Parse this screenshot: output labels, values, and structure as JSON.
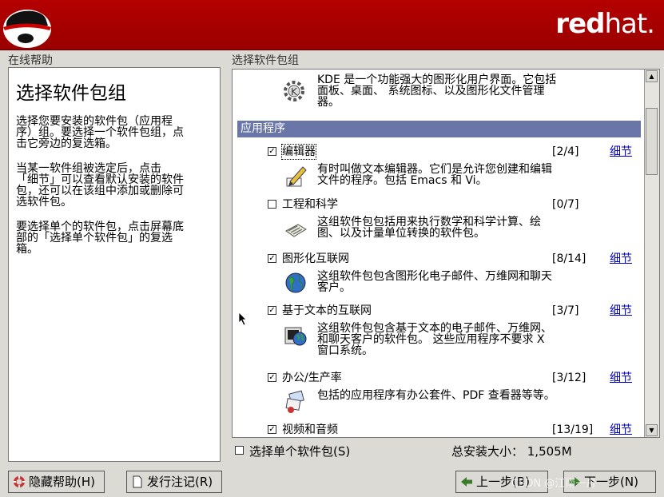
{
  "header": {
    "brand_bold": "red",
    "brand_thin": "hat."
  },
  "help": {
    "section_label": "在线帮助",
    "title": "选择软件包组",
    "paragraphs": [
      [
        "选择您要安装的软件包（应用程",
        "序）组。要选择一个软件包组，点",
        "击它旁边的复选箱。"
      ],
      [
        "当某一软件组被选定后，点击",
        "「细节」可以查看默认安装的软件",
        "包，还可以在该组中添加或删除可",
        "选软件包。"
      ],
      [
        "要选择单个的软件包，点击屏幕底",
        "部的「选择单个软件包」的复选",
        "箱。"
      ]
    ]
  },
  "packages": {
    "section_label": "选择软件包组",
    "kde_desc": [
      "KDE 是一个功能强大的图形化用户界面。它包括",
      "面板、桌面、 系统图标、以及图形化文件管理",
      "器。"
    ],
    "category": "应用程序",
    "groups": [
      {
        "name": "编辑器",
        "checked": true,
        "count": "[2/4]",
        "link": "细节",
        "icon": "edit-pencil-icon",
        "desc": [
          "有时叫做文本编辑器。它们是允许您创建和编辑",
          "文件的程序。包括 Emacs 和 Vi。"
        ]
      },
      {
        "name": "工程和科学",
        "checked": false,
        "count": "[0/7]",
        "link": "",
        "icon": "calculator-icon",
        "desc": [
          "这组软件包包括用来执行数学和科学计算、绘",
          "图、以及计量单位转换的软件包。"
        ]
      },
      {
        "name": "图形化互联网",
        "checked": true,
        "count": "[8/14]",
        "link": "细节",
        "icon": "globe-icon",
        "desc": [
          "这组软件包包含图形化电子邮件、万维网和聊天",
          "客户。"
        ]
      },
      {
        "name": "基于文本的互联网",
        "checked": true,
        "count": "[3/7]",
        "link": "细节",
        "icon": "terminal-globe-icon",
        "desc": [
          "这组软件包包含基于文本的电子邮件、万维网、",
          "和聊天客户的软件包。 这些应用程序不要求 X",
          "窗口系统。"
        ]
      },
      {
        "name": "办公/生产率",
        "checked": true,
        "count": "[3/12]",
        "link": "细节",
        "icon": "office-icon",
        "desc": [
          "包括的应用程序有办公套件、PDF 查看器等等。"
        ]
      },
      {
        "name": "视频和音频",
        "checked": true,
        "count": "[13/19]",
        "link": "细节",
        "icon": "",
        "desc": []
      }
    ],
    "single_select_label": "选择单个软件包(S)",
    "total_size": "总安装大小： 1,505M"
  },
  "buttons": {
    "hide_help": "隐藏帮助(H)",
    "release_notes": "发行注记(R)",
    "back": "上一步(B)",
    "next": "下一步(N)"
  },
  "watermark": "CSDN @江南一舟"
}
